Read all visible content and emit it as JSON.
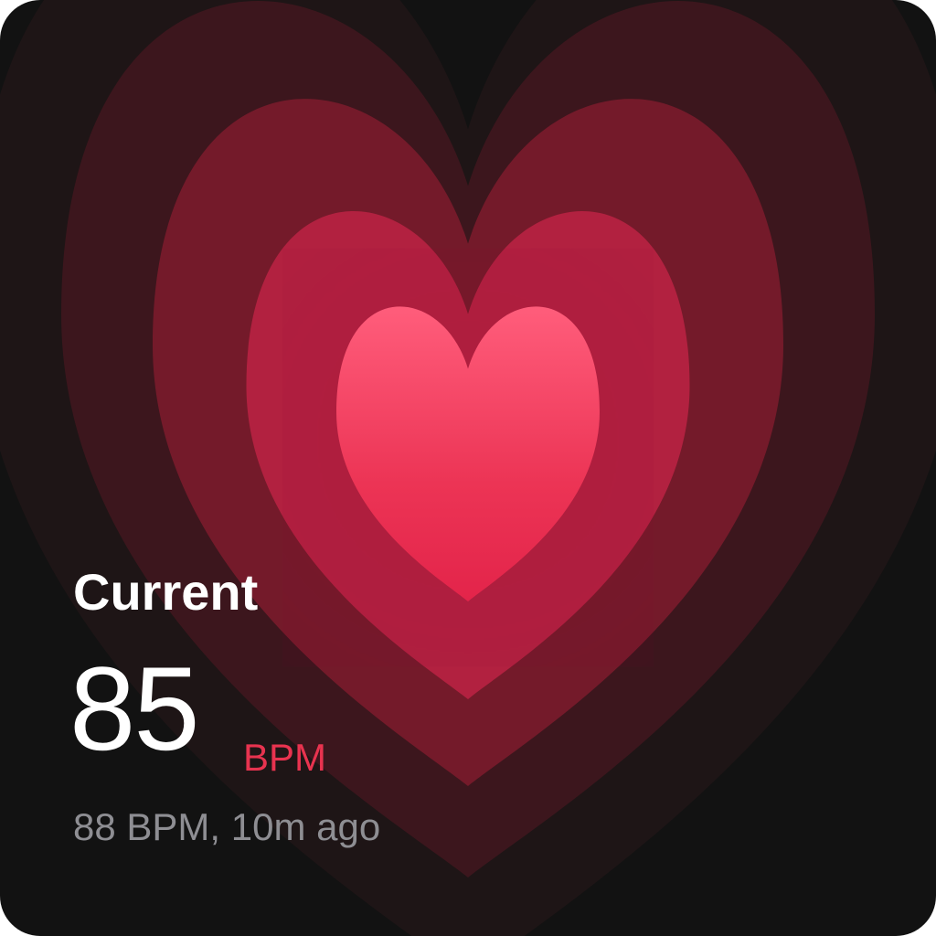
{
  "card": {
    "title": "Current",
    "value": "85",
    "unit": "BPM",
    "previous_reading": "88 BPM, 10m ago"
  },
  "colors": {
    "background": "#121212",
    "accent": "#e8334f",
    "secondary_text": "#8e8e93",
    "heart_center_top": "#ff5a78",
    "heart_center_bottom": "#e5264a"
  },
  "icons": {
    "background": "concentric-heart-rings-icon"
  }
}
